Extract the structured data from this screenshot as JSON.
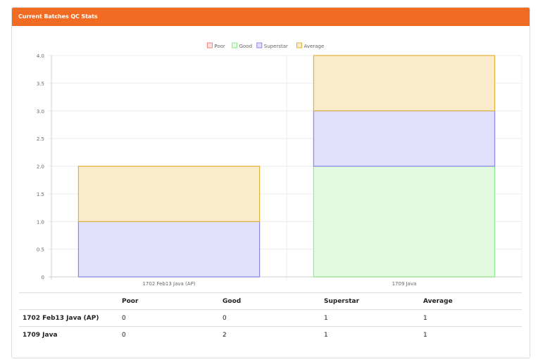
{
  "panel": {
    "title": "Current Batches QC Stats"
  },
  "chart_data": {
    "type": "bar",
    "stacked": true,
    "categories": [
      "1702 Feb13 Java (AP)",
      "1709 Java"
    ],
    "series": [
      {
        "name": "Poor",
        "values": [
          0,
          0
        ],
        "stroke": "#f27f7f",
        "fill": "#fde3e3"
      },
      {
        "name": "Good",
        "values": [
          0,
          2
        ],
        "stroke": "#8fe98f",
        "fill": "#e2fbe0"
      },
      {
        "name": "Superstar",
        "values": [
          1,
          1
        ],
        "stroke": "#8a86e8",
        "fill": "#e0e0fc"
      },
      {
        "name": "Average",
        "values": [
          1,
          1
        ],
        "stroke": "#e0b23a",
        "fill": "#faebcb"
      }
    ],
    "ylim": [
      0,
      4.0
    ],
    "yticks": [
      "0",
      "0.5",
      "1.0",
      "1.5",
      "2.0",
      "2.5",
      "3.0",
      "3.5",
      "4.0"
    ],
    "grid": true,
    "legend_position": "top"
  },
  "table": {
    "headers": [
      "",
      "Poor",
      "Good",
      "Superstar",
      "Average"
    ],
    "rows": [
      {
        "name": "1702 Feb13 Java (AP)",
        "poor": "0",
        "good": "0",
        "superstar": "1",
        "average": "1"
      },
      {
        "name": "1709 Java",
        "poor": "0",
        "good": "2",
        "superstar": "1",
        "average": "1"
      }
    ]
  }
}
